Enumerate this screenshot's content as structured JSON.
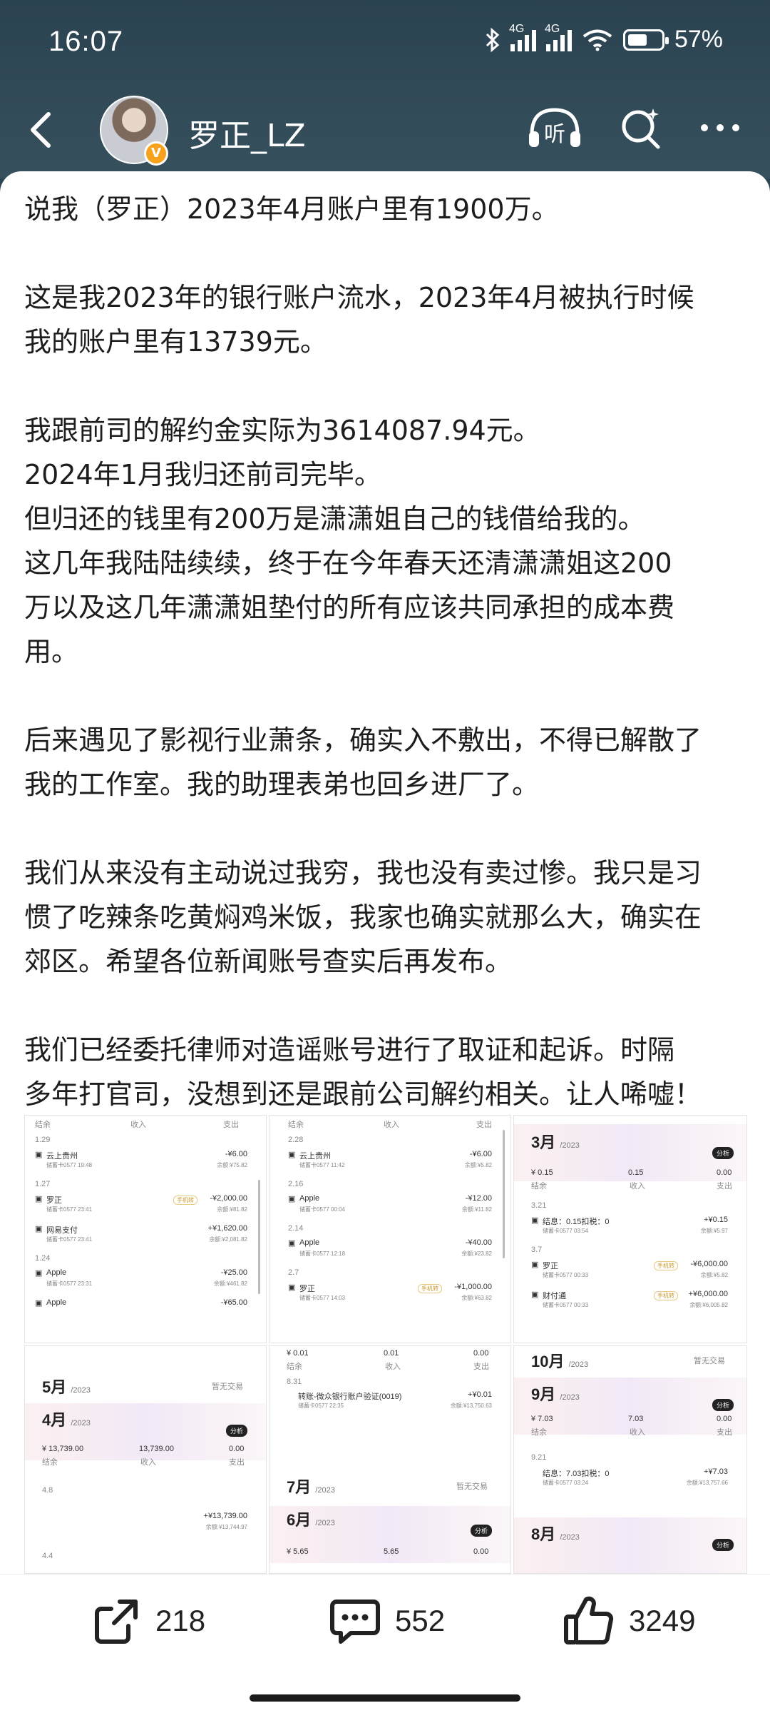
{
  "status": {
    "time": "16:07",
    "battery": "57%",
    "net1": "4G",
    "net2": "4G",
    "wifi_label": "6"
  },
  "header": {
    "username": "罗正_LZ",
    "verified_badge": "V"
  },
  "post": {
    "paragraphs": [
      "说我（罗正）2023年4月账户里有1900万。",
      "这是我2023年的银行账户流水，2023年4月被执行时候我的账户里有13739元。",
      "我跟前司的解约金实际为3614087.94元。\n2024年1月我归还前司完毕。\n但归还的钱里有200万是潇潇姐自己的钱借给我的。\n这几年我陆陆续续，终于在今年春天还清潇潇姐这200万以及这几年潇潇姐垫付的所有应该共同承担的成本费用。",
      "后来遇见了影视行业萧条，确实入不敷出，不得已解散了我的工作室。我的助理表弟也回乡进厂了。",
      "我们从来没有主动说过我穷，我也没有卖过惨。我只是习惯了吃辣条吃黄焖鸡米饭，我家也确实就那么大，确实在郊区。希望各位新闻账号查实后再发布。",
      "我们已经委托律师对造谣账号进行了取证和起诉。时隔多年打官司，没想到还是跟前公司解约相关。让人唏嘘！"
    ],
    "line_texts": [
      "说我（罗正）2023年4月账户里有1900万。",
      "",
      "这是我2023年的银行账户流水，2023年4月被执行时候",
      "我的账户里有13739元。",
      "",
      "我跟前司的解约金实际为3614087.94元。",
      "2024年1月我归还前司完毕。",
      "但归还的钱里有200万是潇潇姐自己的钱借给我的。",
      "这几年我陆陆续续，终于在今年春天还清潇潇姐这200",
      "万以及这几年潇潇姐垫付的所有应该共同承担的成本费",
      "用。",
      "",
      "后来遇见了影视行业萧条，确实入不敷出，不得已解散了",
      "我的工作室。我的助理表弟也回乡进厂了。",
      "",
      "我们从来没有主动说过我穷，我也没有卖过惨。我只是习",
      "惯了吃辣条吃黄焖鸡米饭，我家也确实就那么大，确实在",
      "郊区。希望各位新闻账号查实后再发布。",
      "",
      "我们已经委托律师对造谣账号进行了取证和起诉。时隔",
      "多年打官司，没想到还是跟前公司解约相关。让人唏嘘！"
    ]
  },
  "shots": {
    "s1": {
      "hdr": [
        "结余",
        "收入",
        "支出"
      ],
      "items": [
        {
          "date": "1.29",
          "name": "云上贵州",
          "sub": "储蓄卡0577 19:48",
          "amt": "-¥6.00",
          "bal": "余额:¥75.82"
        },
        {
          "date": "1.27",
          "name": "罗正",
          "sub": "储蓄卡0577 23:41",
          "amt": "-¥2,000.00",
          "bal": "余额:¥81.82",
          "tag": "手机转"
        },
        {
          "date": "",
          "name": "网易支付",
          "sub": "储蓄卡0577 23:41",
          "amt": "+¥1,620.00",
          "bal": "余额:¥2,081.82"
        },
        {
          "date": "1.24",
          "name": "Apple",
          "sub": "储蓄卡0577 23:31",
          "amt": "-¥25.00",
          "bal": "余额:¥461.82"
        },
        {
          "date": "",
          "name": "Apple",
          "sub": "",
          "amt": "-¥65.00",
          "bal": ""
        }
      ]
    },
    "s2": {
      "hdr": [
        "结余",
        "收入",
        "支出"
      ],
      "items": [
        {
          "date": "2.28",
          "name": "云上贵州",
          "sub": "储蓄卡0577 11:42",
          "amt": "-¥6.00",
          "bal": "余额:¥5.82"
        },
        {
          "date": "2.16",
          "name": "Apple",
          "sub": "储蓄卡0577 00:04",
          "amt": "-¥12.00",
          "bal": "余额:¥11.82"
        },
        {
          "date": "2.14",
          "name": "Apple",
          "sub": "储蓄卡0577 12:18",
          "amt": "-¥40.00",
          "bal": "余额:¥23.82"
        },
        {
          "date": "2.7",
          "name": "罗正",
          "sub": "储蓄卡0577 14:03",
          "amt": "-¥1,000.00",
          "bal": "余额:¥63.82",
          "tag": "手机转"
        }
      ]
    },
    "s3": {
      "month": "3月",
      "year": "/2023",
      "pill": "分析",
      "sum": [
        "¥ 0.15",
        "0.15",
        "0.00"
      ],
      "sumlbl": [
        "结余",
        "收入",
        "支出"
      ],
      "items": [
        {
          "date": "3.21",
          "name": "结息：0.15扣税：0",
          "sub": "储蓄卡0577 03:54",
          "amt": "+¥0.15",
          "bal": "余额:¥5.97"
        },
        {
          "date": "3.7",
          "name": "罗正",
          "sub": "储蓄卡0577 00:33",
          "amt": "-¥6,000.00",
          "bal": "余额:¥5.82",
          "tag": "手机转"
        },
        {
          "date": "",
          "name": "财付通",
          "sub": "储蓄卡0577 00:33",
          "amt": "+¥6,000.00",
          "bal": "余额:¥6,005.82",
          "tag": "手机转"
        }
      ]
    },
    "s4": {
      "m5": "5月",
      "m5y": "/2023",
      "m5note": "暂无交易",
      "m4": "4月",
      "m4y": "/2023",
      "pill": "分析",
      "sum": [
        "¥ 13,739.00",
        "13,739.00",
        "0.00"
      ],
      "sumlbl": [
        "结余",
        "收入",
        "支出"
      ],
      "d1": "4.8",
      "amt": "+¥13,739.00",
      "bal": "余额:¥13,744.97",
      "d2": "4.4"
    },
    "s5": {
      "sum": [
        "¥ 0.01",
        "0.01",
        "0.00"
      ],
      "sumlbl": [
        "结余",
        "收入",
        "支出"
      ],
      "d1": "8.31",
      "name": "转账-微众银行账户验证(0019)",
      "sub": "储蓄卡0577 22:35",
      "amt": "+¥0.01",
      "bal": "余额:¥13,750.63",
      "m7": "7月",
      "m7y": "/2023",
      "m7note": "暂无交易",
      "m6": "6月",
      "m6y": "/2023",
      "pill": "分析",
      "sum6": [
        "¥ 5.65",
        "5.65",
        "0.00"
      ]
    },
    "s6": {
      "m10": "10月",
      "m10y": "/2023",
      "m10note": "暂无交易",
      "m9": "9月",
      "m9y": "/2023",
      "pill": "分析",
      "sum": [
        "¥ 7.03",
        "7.03",
        "0.00"
      ],
      "sumlbl": [
        "结余",
        "收入",
        "支出"
      ],
      "d1": "9.21",
      "name": "结息：7.03扣税：0",
      "sub": "储蓄卡0577 03:24",
      "amt": "+¥7.03",
      "bal": "余额:¥13,757.66",
      "m8": "8月",
      "m8y": "/2023"
    }
  },
  "actions": {
    "share": "218",
    "comment": "552",
    "like": "3249"
  }
}
